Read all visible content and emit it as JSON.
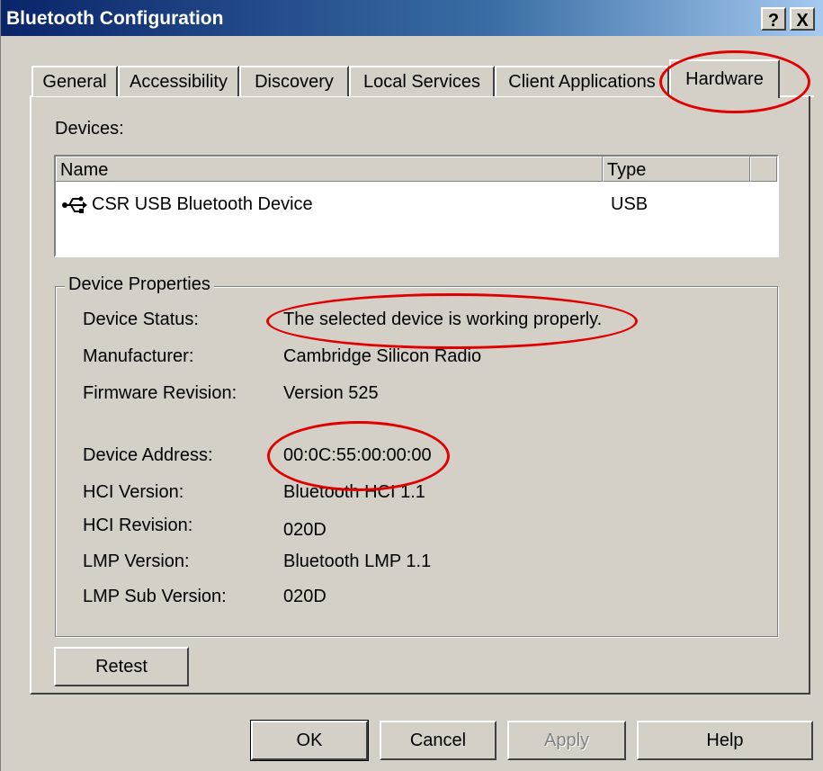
{
  "window": {
    "title": "Bluetooth Configuration",
    "help_button": "?",
    "close_button": "X"
  },
  "tabs": [
    {
      "label": "General"
    },
    {
      "label": "Accessibility"
    },
    {
      "label": "Discovery"
    },
    {
      "label": "Local Services"
    },
    {
      "label": "Client Applications"
    },
    {
      "label": "Hardware",
      "active": true
    }
  ],
  "devices": {
    "label": "Devices:",
    "columns": [
      "Name",
      "Type"
    ],
    "rows": [
      {
        "icon": "usb-icon",
        "name": "CSR USB Bluetooth Device",
        "type": "USB"
      }
    ]
  },
  "device_properties": {
    "legend": "Device Properties",
    "items": [
      {
        "label": "Device Status:",
        "value": "The selected device is working properly."
      },
      {
        "label": "Manufacturer:",
        "value": "Cambridge Silicon Radio"
      },
      {
        "label": "Firmware Revision:",
        "value": "Version 525"
      },
      {
        "label": "Device Address:",
        "value": "00:0C:55:00:00:00"
      },
      {
        "label": "HCI Version:",
        "value": "Bluetooth HCI 1.1"
      },
      {
        "label": "HCI Revision:",
        "value": "020D"
      },
      {
        "label": "LMP Version:",
        "value": "Bluetooth LMP 1.1"
      },
      {
        "label": "LMP Sub Version:",
        "value": "020D"
      }
    ]
  },
  "buttons": {
    "retest": "Retest",
    "ok": "OK",
    "cancel": "Cancel",
    "apply": "Apply",
    "help": "Help"
  },
  "annotation_color": "#e00000"
}
